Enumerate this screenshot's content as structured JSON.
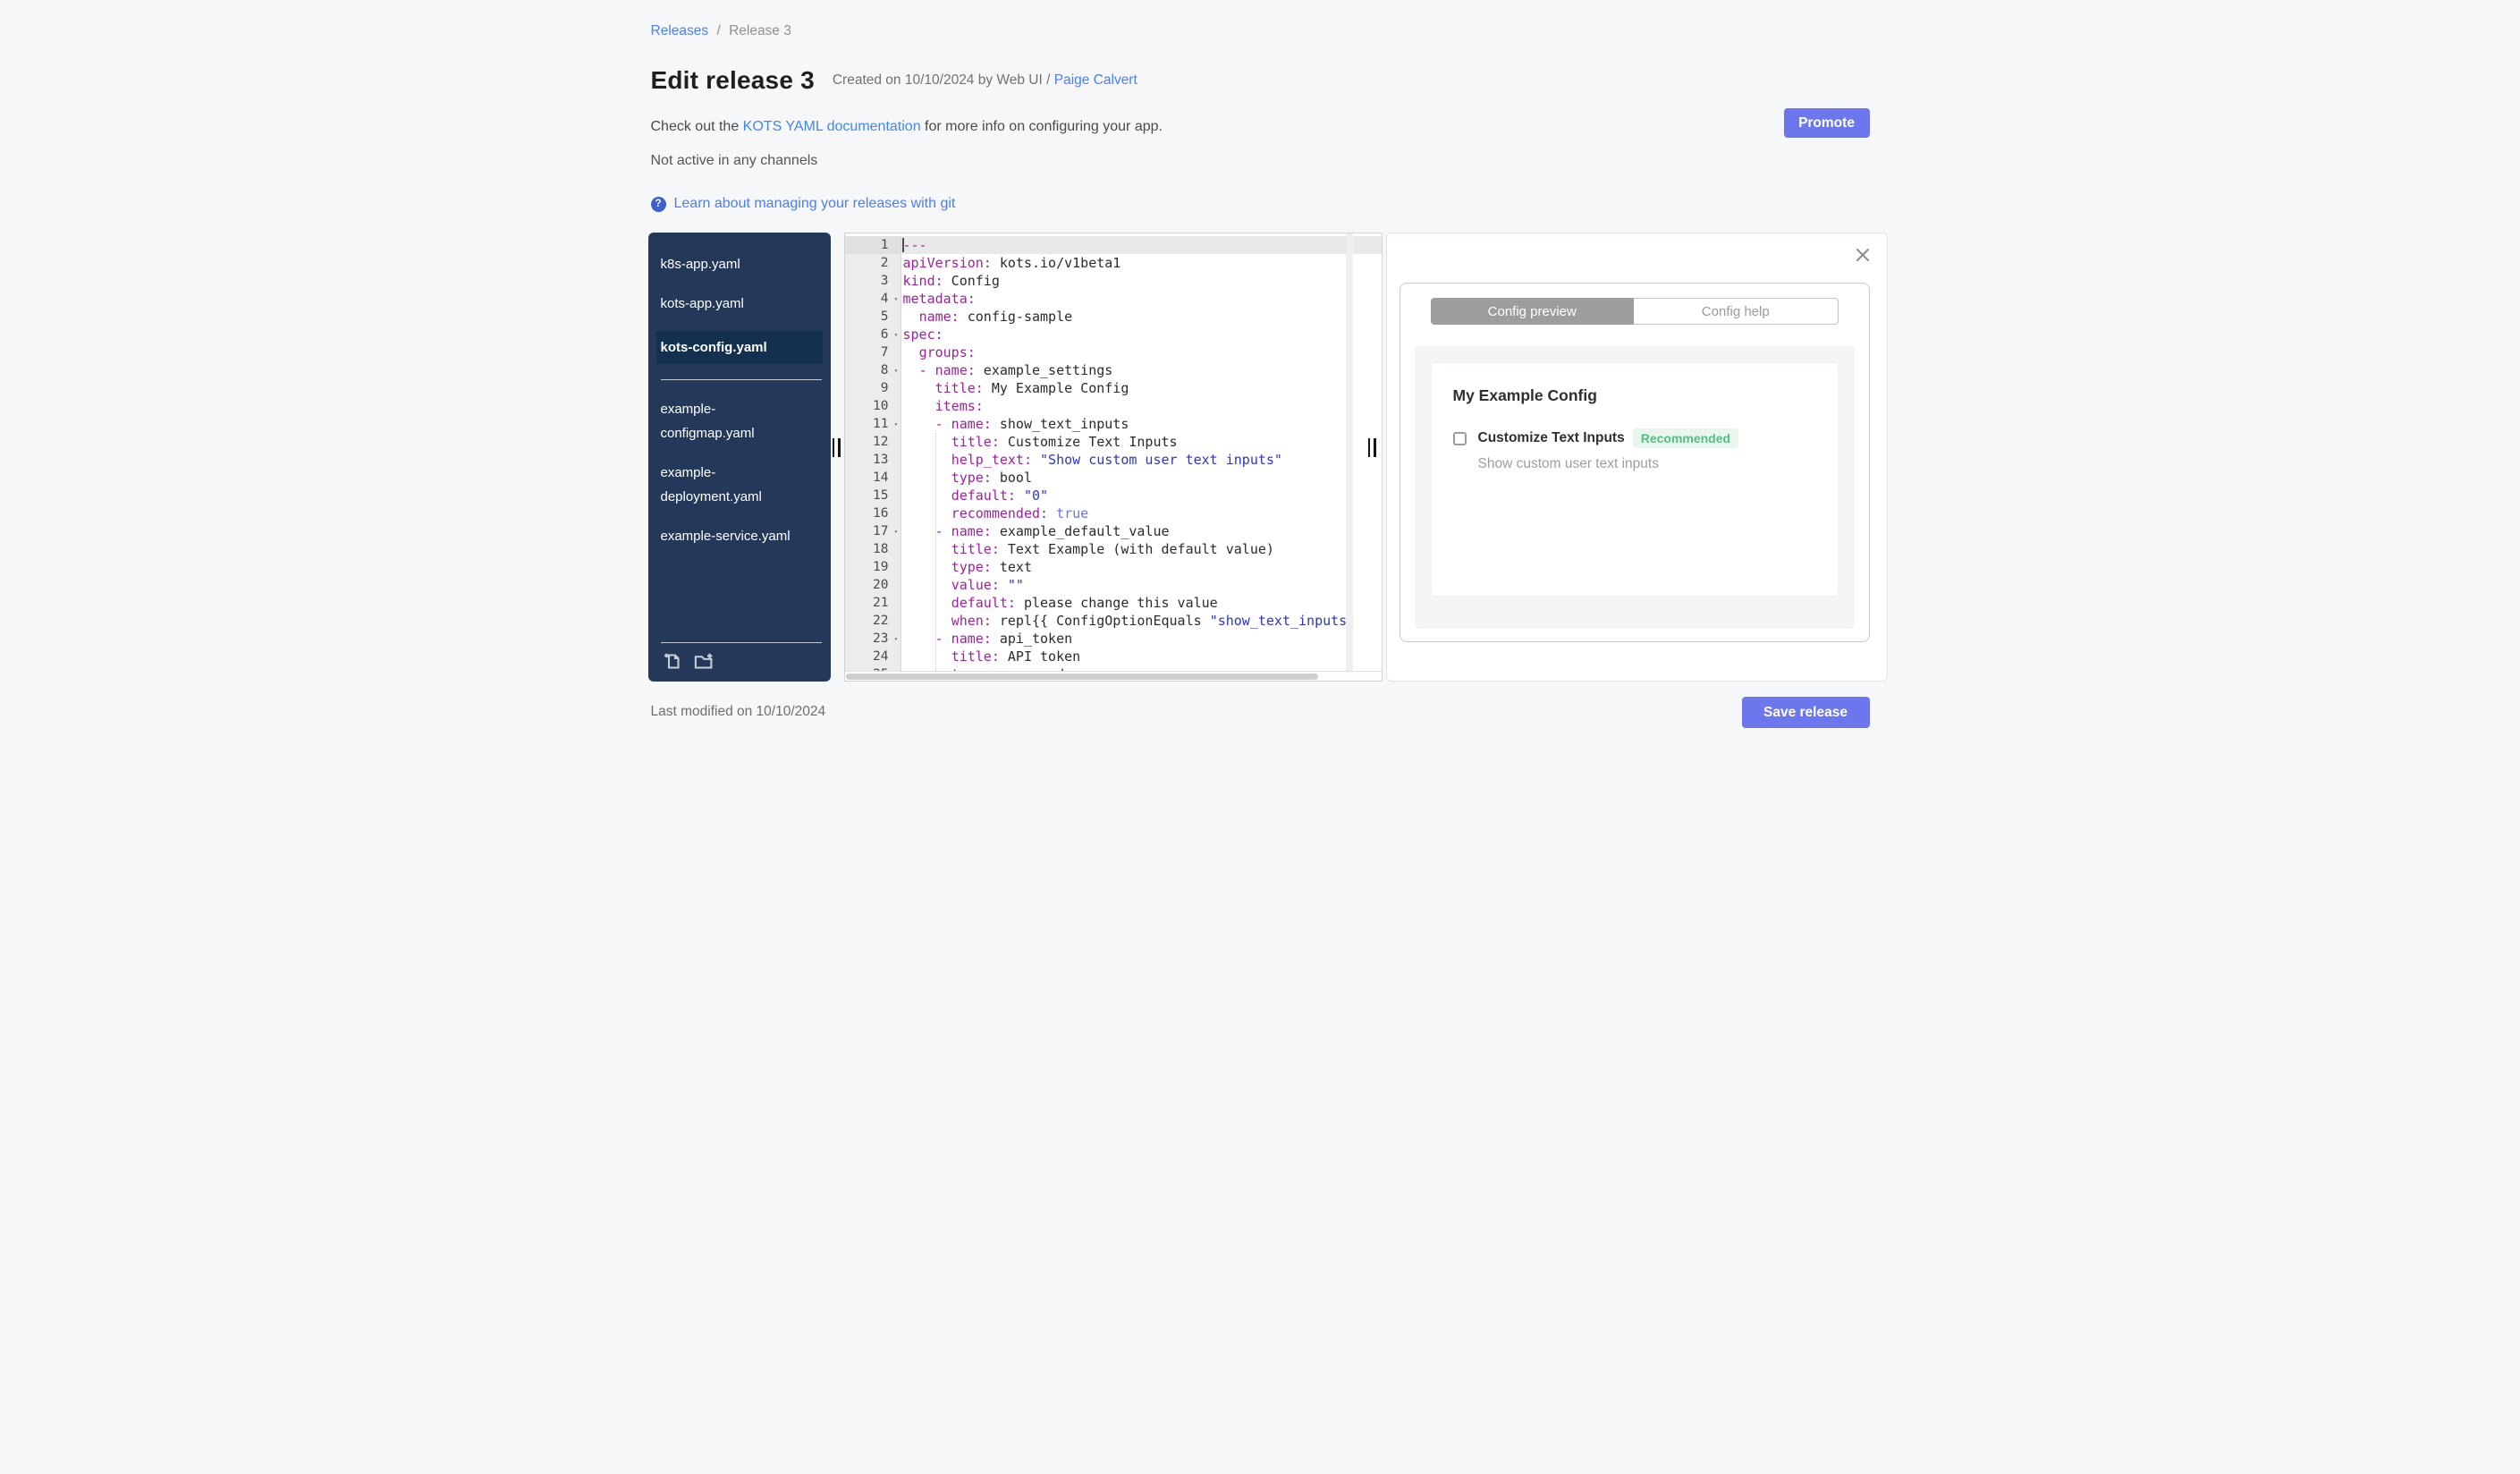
{
  "breadcrumb": {
    "link": "Releases",
    "separator": "/",
    "current": "Release 3"
  },
  "header": {
    "title": "Edit release 3",
    "created_prefix": "Created on 10/10/2024 by Web UI / ",
    "created_author": "Paige Calvert",
    "doc_prefix": "Check out the ",
    "doc_link": "KOTS YAML documentation",
    "doc_suffix": " for more info on configuring your app.",
    "channel_status": "Not active in any channels",
    "git_help_icon": "?",
    "git_link": "Learn about managing your releases with git",
    "promote_label": "Promote"
  },
  "sidebar": {
    "files": [
      {
        "label": "k8s-app.yaml",
        "selected": false,
        "group": 1
      },
      {
        "label": "kots-app.yaml",
        "selected": false,
        "group": 1
      },
      {
        "label": "kots-config.yaml",
        "selected": true,
        "group": 1
      },
      {
        "label": "example-configmap.yaml",
        "selected": false,
        "group": 2
      },
      {
        "label": "example-deployment.yaml",
        "selected": false,
        "group": 2
      },
      {
        "label": "example-service.yaml",
        "selected": false,
        "group": 2
      }
    ],
    "icons": [
      "add-file-icon",
      "add-folder-icon"
    ]
  },
  "editor": {
    "active_line": 1,
    "fold_lines": [
      4,
      6,
      8,
      11,
      17,
      23
    ],
    "lines": [
      [
        [
          "k",
          "---"
        ]
      ],
      [
        [
          "k",
          "apiVersion:"
        ],
        [
          "p",
          " kots.io/v1beta1"
        ]
      ],
      [
        [
          "k",
          "kind:"
        ],
        [
          "p",
          " Config"
        ]
      ],
      [
        [
          "k",
          "metadata:"
        ]
      ],
      [
        [
          "p",
          "  "
        ],
        [
          "k",
          "name:"
        ],
        [
          "p",
          " config-sample"
        ]
      ],
      [
        [
          "k",
          "spec:"
        ]
      ],
      [
        [
          "p",
          "  "
        ],
        [
          "k",
          "groups:"
        ]
      ],
      [
        [
          "p",
          "  "
        ],
        [
          "k",
          "- name:"
        ],
        [
          "p",
          " example_settings"
        ]
      ],
      [
        [
          "p",
          "    "
        ],
        [
          "k",
          "title:"
        ],
        [
          "p",
          " My Example Config"
        ]
      ],
      [
        [
          "p",
          "    "
        ],
        [
          "k",
          "items:"
        ]
      ],
      [
        [
          "p",
          "    "
        ],
        [
          "k",
          "- name:"
        ],
        [
          "p",
          " show_text_inputs"
        ]
      ],
      [
        [
          "p",
          "      "
        ],
        [
          "k",
          "title:"
        ],
        [
          "p",
          " Customize Text Inputs"
        ]
      ],
      [
        [
          "p",
          "      "
        ],
        [
          "k",
          "help_text:"
        ],
        [
          "p",
          " "
        ],
        [
          "s",
          "\"Show custom user text inputs\""
        ]
      ],
      [
        [
          "p",
          "      "
        ],
        [
          "k",
          "type:"
        ],
        [
          "p",
          " bool"
        ]
      ],
      [
        [
          "p",
          "      "
        ],
        [
          "k",
          "default:"
        ],
        [
          "p",
          " "
        ],
        [
          "s",
          "\"0\""
        ]
      ],
      [
        [
          "p",
          "      "
        ],
        [
          "k",
          "recommended:"
        ],
        [
          "p",
          " "
        ],
        [
          "b",
          "true"
        ]
      ],
      [
        [
          "p",
          "    "
        ],
        [
          "k",
          "- name:"
        ],
        [
          "p",
          " example_default_value"
        ]
      ],
      [
        [
          "p",
          "      "
        ],
        [
          "k",
          "title:"
        ],
        [
          "p",
          " Text Example (with default value)"
        ]
      ],
      [
        [
          "p",
          "      "
        ],
        [
          "k",
          "type:"
        ],
        [
          "p",
          " text"
        ]
      ],
      [
        [
          "p",
          "      "
        ],
        [
          "k",
          "value:"
        ],
        [
          "p",
          " "
        ],
        [
          "s",
          "\"\""
        ]
      ],
      [
        [
          "p",
          "      "
        ],
        [
          "k",
          "default:"
        ],
        [
          "p",
          " please change this value"
        ]
      ],
      [
        [
          "p",
          "      "
        ],
        [
          "k",
          "when:"
        ],
        [
          "p",
          " repl{{ ConfigOptionEquals "
        ],
        [
          "s",
          "\"show_text_inputs\""
        ]
      ],
      [
        [
          "p",
          "    "
        ],
        [
          "k",
          "- name:"
        ],
        [
          "p",
          " api_token"
        ]
      ],
      [
        [
          "p",
          "      "
        ],
        [
          "k",
          "title:"
        ],
        [
          "p",
          " API token"
        ]
      ],
      [
        [
          "p",
          "      "
        ],
        [
          "k",
          "type:"
        ],
        [
          "p",
          " password"
        ]
      ]
    ]
  },
  "preview": {
    "tab_active": "Config preview",
    "tab_inactive": "Config help",
    "group_title": "My Example Config",
    "item_label": "Customize Text Inputs",
    "item_badge": "Recommended",
    "item_help": "Show custom user text inputs",
    "checkbox_checked": false
  },
  "footer": {
    "last_modified": "Last modified on 10/10/2024",
    "save_label": "Save release"
  },
  "colors": {
    "accent": "#6c77ee",
    "link": "#4a7df8",
    "sidebar_bg": "#24395a",
    "sidebar_selected": "#13304f",
    "badge_bg": "#e8f6ee",
    "badge_text": "#56bd86",
    "code_key": "#a0219e",
    "code_string": "#2d35c4",
    "code_bool": "#6a73ea"
  }
}
